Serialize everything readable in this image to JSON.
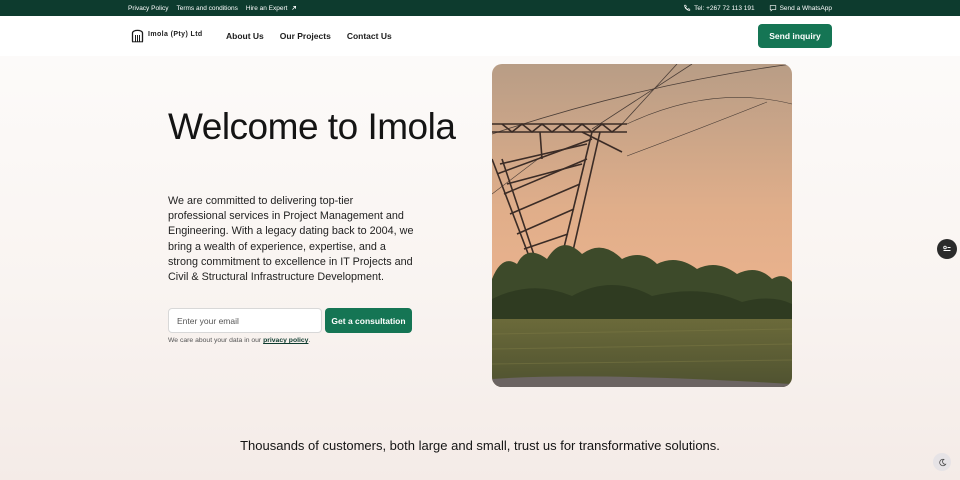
{
  "topbar": {
    "links": [
      "Privacy Policy",
      "Terms and conditions",
      "Hire an Expert"
    ],
    "phone": "Tel: +267 72 113 191",
    "whatsapp": "Send a WhatsApp"
  },
  "nav": {
    "logo_text": "Imola (Pty) Ltd",
    "menu": [
      "About Us",
      "Our Projects",
      "Contact Us"
    ],
    "cta": "Send inquiry"
  },
  "hero": {
    "title": "Welcome to Imola",
    "description": "We are committed to delivering top-tier professional services in Project Management and Engineering. With a legacy dating back to 2004, we bring a wealth of experience, expertise, and a strong commitment to excellence in IT Projects and Civil & Structural Infrastructure Development.",
    "email_placeholder": "Enter your email",
    "email_value": "",
    "button": "Get a consultation",
    "privacy_prefix": "We care about your data in our ",
    "privacy_link": "privacy policy",
    "privacy_suffix": "."
  },
  "trust_text": "Thousands of customers, both large and small, trust us for transformative solutions.",
  "colors": {
    "topbar": "#0d3b2e",
    "accent": "#157554",
    "background": "#fdfcfb"
  },
  "icons": [
    "external-link-icon",
    "phone-icon",
    "chat-icon",
    "logo-icon",
    "accessibility-icon",
    "moon-icon"
  ]
}
